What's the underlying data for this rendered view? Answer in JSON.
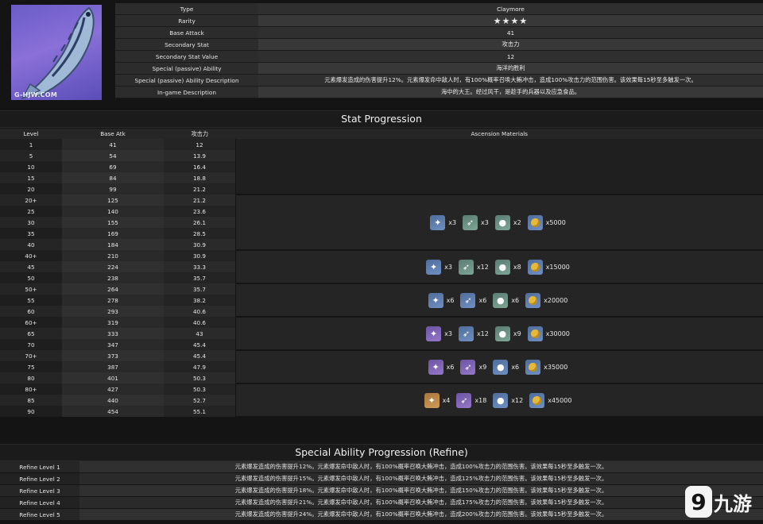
{
  "watermark": "G-HJW.COM",
  "info": [
    {
      "key": "Type",
      "value": "Claymore"
    },
    {
      "key": "Rarity",
      "value": "★★★★"
    },
    {
      "key": "Base Attack",
      "value": "41"
    },
    {
      "key": "Secondary Stat",
      "value": "攻击力"
    },
    {
      "key": "Secondary Stat Value",
      "value": "12"
    },
    {
      "key": "Special (passive) Ability",
      "value": "海洋的胜利"
    },
    {
      "key": "Special (passive) Ability Description",
      "value": "元素爆发造成的伤害提升12%。元素爆发命中敌人时，有100%概率召唤大鲔冲击，造成100%攻击力的范围伤害。该效果每15秒至多触发一次。"
    },
    {
      "key": "In-game Description",
      "value": "海中的大王。经过风干，是趁手的兵器以及应急食品。"
    }
  ],
  "colors": {
    "claymore": "#e3b92f",
    "stars": "#f2d300"
  },
  "stat_progression": {
    "title": "Stat Progression",
    "headers": {
      "level": "Level",
      "base_atk": "Base Atk",
      "sub": "攻击力",
      "materials": "Ascension Materials"
    },
    "rows": [
      [
        "1",
        "41",
        "12"
      ],
      [
        "5",
        "54",
        "13.9"
      ],
      [
        "10",
        "69",
        "16.4"
      ],
      [
        "15",
        "84",
        "18.8"
      ],
      [
        "20",
        "99",
        "21.2"
      ],
      [
        "20+",
        "125",
        "21.2"
      ],
      [
        "25",
        "140",
        "23.6"
      ],
      [
        "30",
        "155",
        "26.1"
      ],
      [
        "35",
        "169",
        "28.5"
      ],
      [
        "40",
        "184",
        "30.9"
      ],
      [
        "40+",
        "210",
        "30.9"
      ],
      [
        "45",
        "224",
        "33.3"
      ],
      [
        "50",
        "238",
        "35.7"
      ],
      [
        "50+",
        "264",
        "35.7"
      ],
      [
        "55",
        "278",
        "38.2"
      ],
      [
        "60",
        "293",
        "40.6"
      ],
      [
        "60+",
        "319",
        "40.6"
      ],
      [
        "65",
        "333",
        "43"
      ],
      [
        "70",
        "347",
        "45.4"
      ],
      [
        "70+",
        "373",
        "45.4"
      ],
      [
        "75",
        "387",
        "47.9"
      ],
      [
        "80",
        "401",
        "50.3"
      ],
      [
        "80+",
        "427",
        "50.3"
      ],
      [
        "85",
        "440",
        "52.7"
      ],
      [
        "90",
        "454",
        "55.1"
      ]
    ],
    "materials": [
      {
        "items": [
          {
            "icon": "bone-shard-icon",
            "rarity": "r3",
            "qty": "x3"
          },
          {
            "icon": "arrowhead-icon",
            "rarity": "r2",
            "qty": "x3"
          },
          {
            "icon": "slime-condensate-icon",
            "rarity": "r2",
            "qty": "x2"
          },
          {
            "icon": "mora-icon",
            "rarity": "mora",
            "qty": "x5000"
          }
        ]
      },
      {
        "items": [
          {
            "icon": "bone-shard-icon",
            "rarity": "r3",
            "qty": "x3"
          },
          {
            "icon": "arrowhead-icon",
            "rarity": "r2",
            "qty": "x12"
          },
          {
            "icon": "slime-condensate-icon",
            "rarity": "r2",
            "qty": "x8"
          },
          {
            "icon": "mora-icon",
            "rarity": "mora",
            "qty": "x15000"
          }
        ]
      },
      {
        "items": [
          {
            "icon": "bone-shard-icon",
            "rarity": "r3",
            "qty": "x6"
          },
          {
            "icon": "arrowhead-icon",
            "rarity": "r3",
            "qty": "x6"
          },
          {
            "icon": "slime-secretions-icon",
            "rarity": "r2",
            "qty": "x6"
          },
          {
            "icon": "mora-icon",
            "rarity": "mora",
            "qty": "x20000"
          }
        ]
      },
      {
        "items": [
          {
            "icon": "bone-shard-icon",
            "rarity": "r4",
            "qty": "x3"
          },
          {
            "icon": "arrowhead-icon",
            "rarity": "r3",
            "qty": "x12"
          },
          {
            "icon": "slime-secretions-icon",
            "rarity": "r2",
            "qty": "x9"
          },
          {
            "icon": "mora-icon",
            "rarity": "mora",
            "qty": "x30000"
          }
        ]
      },
      {
        "items": [
          {
            "icon": "bone-shard-icon",
            "rarity": "r4",
            "qty": "x6"
          },
          {
            "icon": "arrowhead-icon",
            "rarity": "r4",
            "qty": "x9"
          },
          {
            "icon": "slime-concentrate-icon",
            "rarity": "r3",
            "qty": "x6"
          },
          {
            "icon": "mora-icon",
            "rarity": "mora",
            "qty": "x35000"
          }
        ]
      },
      {
        "items": [
          {
            "icon": "bone-shard-icon",
            "rarity": "r5",
            "qty": "x4"
          },
          {
            "icon": "arrowhead-icon",
            "rarity": "r4",
            "qty": "x18"
          },
          {
            "icon": "slime-concentrate-icon",
            "rarity": "r3",
            "qty": "x12"
          },
          {
            "icon": "mora-icon",
            "rarity": "mora",
            "qty": "x45000"
          }
        ]
      }
    ]
  },
  "refine": {
    "title": "Special Ability Progression (Refine)",
    "rows": [
      {
        "label": "Refine Level 1",
        "text": "元素爆发造成的伤害提升12%。元素爆发命中敌人时，有100%概率召唤大鲔冲击，造成100%攻击力的范围伤害。该效果每15秒至多触发一次。"
      },
      {
        "label": "Refine Level 2",
        "text": "元素爆发造成的伤害提升15%。元素爆发命中敌人时，有100%概率召唤大鲔冲击，造成125%攻击力的范围伤害。该效果每15秒至多触发一次。"
      },
      {
        "label": "Refine Level 3",
        "text": "元素爆发造成的伤害提升18%。元素爆发命中敌人时，有100%概率召唤大鲔冲击，造成150%攻击力的范围伤害。该效果每15秒至多触发一次。"
      },
      {
        "label": "Refine Level 4",
        "text": "元素爆发造成的伤害提升21%。元素爆发命中敌人时，有100%概率召唤大鲔冲击，造成175%攻击力的范围伤害。该效果每15秒至多触发一次。"
      },
      {
        "label": "Refine Level 5",
        "text": "元素爆发造成的伤害提升24%。元素爆发命中敌人时，有100%概率召唤大鲔冲击，造成200%攻击力的范围伤害。该效果每15秒至多触发一次。"
      }
    ]
  },
  "logo": {
    "text": "九游"
  }
}
